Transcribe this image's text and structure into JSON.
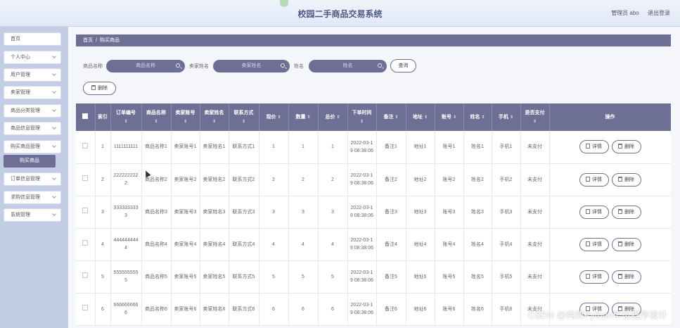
{
  "header": {
    "title": "校园二手商品交易系统",
    "user": "管理员 abo",
    "logout": "退出登录"
  },
  "sidebar": {
    "items": [
      {
        "label": "首页"
      },
      {
        "label": "个人中心"
      },
      {
        "label": "用户管理"
      },
      {
        "label": "卖家管理"
      },
      {
        "label": "商品分类管理"
      },
      {
        "label": "商品信息管理"
      },
      {
        "label": "购买商品管理"
      },
      {
        "label": "订单信息管理"
      },
      {
        "label": "求购信息管理"
      },
      {
        "label": "系统管理"
      }
    ],
    "active_sub": "购买商品"
  },
  "breadcrumb": {
    "home": "首页",
    "sep": "/",
    "current": "购买商品"
  },
  "search": {
    "label1": "商品名称",
    "placeholder1": "商品名称",
    "label2": "卖家姓名",
    "placeholder2": "卖家姓名",
    "label3": "姓名",
    "placeholder3": "姓名",
    "query_button": "查询"
  },
  "toolbar": {
    "delete_button": "删除"
  },
  "table": {
    "columns": [
      "索引",
      "订单编号",
      "商品名称",
      "卖家账号",
      "卖家姓名",
      "联系方式",
      "现价",
      "数量",
      "总价",
      "下单时间",
      "备注",
      "地址",
      "账号",
      "姓名",
      "手机",
      "是否支付",
      "操作"
    ],
    "sort_glyph": "⇕",
    "detail_label": "详情",
    "delete_label": "删除",
    "rows": [
      [
        "1",
        "1111111111",
        "商品名称1",
        "卖家账号1",
        "卖家姓名1",
        "联系方式1",
        "1",
        "1",
        "1",
        "2022-03-19 08:38:06",
        "备注1",
        "地址1",
        "账号1",
        "姓名1",
        "手机1",
        "未支付"
      ],
      [
        "2",
        "2222222222",
        "商品名称2",
        "卖家账号2",
        "卖家姓名2",
        "联系方式2",
        "2",
        "2",
        "2",
        "2022-03-19 08:38:06",
        "备注2",
        "地址2",
        "账号2",
        "姓名2",
        "手机2",
        "未支付"
      ],
      [
        "3",
        "3333333333",
        "商品名称3",
        "卖家账号3",
        "卖家姓名3",
        "联系方式3",
        "3",
        "3",
        "3",
        "2022-03-19 08:38:06",
        "备注3",
        "地址3",
        "账号3",
        "姓名3",
        "手机3",
        "未支付"
      ],
      [
        "4",
        "4444444444",
        "商品名称4",
        "卖家账号4",
        "卖家姓名4",
        "联系方式4",
        "4",
        "4",
        "4",
        "2022-03-19 08:38:06",
        "备注4",
        "地址4",
        "账号4",
        "姓名4",
        "手机4",
        "未支付"
      ],
      [
        "5",
        "5555555555",
        "商品名称5",
        "卖家账号5",
        "卖家姓名5",
        "联系方式5",
        "5",
        "5",
        "5",
        "2022-03-19 08:38:06",
        "备注5",
        "地址5",
        "账号5",
        "姓名5",
        "手机5",
        "未支付"
      ],
      [
        "6",
        "6666666666",
        "商品名称6",
        "卖家账号6",
        "卖家姓名6",
        "联系方式6",
        "6",
        "6",
        "6",
        "2022-03-19 08:38:06",
        "备注6",
        "地址6",
        "账号6",
        "姓名6",
        "手机6",
        "未支付"
      ]
    ]
  },
  "watermark": "CSDN @纯清Python毕设程序设计"
}
